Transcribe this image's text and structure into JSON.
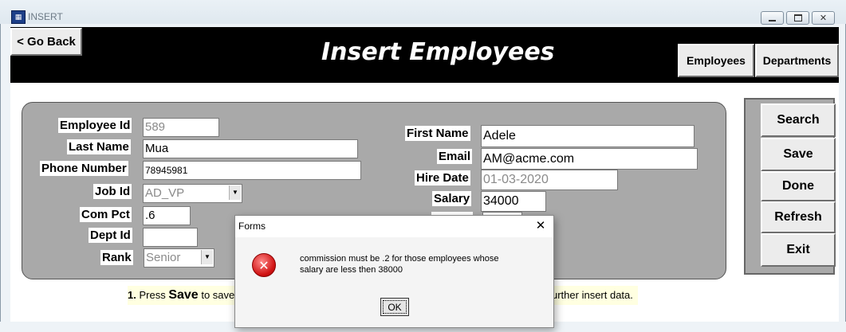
{
  "window": {
    "title": "INSERT",
    "icon": "app-icon",
    "controls": [
      "minimize-icon",
      "restore-icon",
      "close-icon"
    ]
  },
  "header": {
    "go_back": "< Go Back",
    "title": "Insert Employees",
    "nav": {
      "employees": "Employees",
      "departments": "Departments"
    }
  },
  "form": {
    "employee_id": {
      "label": "Employee Id",
      "value": "589"
    },
    "last_name": {
      "label": "Last Name",
      "value": "Mua"
    },
    "phone_number": {
      "label": "Phone Number",
      "value": "78945981"
    },
    "job_id": {
      "label": "Job Id",
      "value": "AD_VP"
    },
    "com_pct": {
      "label": "Com Pct",
      "value": ".6"
    },
    "dept_id": {
      "label": "Dept Id",
      "value": ""
    },
    "rank": {
      "label": "Rank",
      "value": "Senior"
    },
    "first_name": {
      "label": "First Name",
      "value": "Adele"
    },
    "email": {
      "label": "Email",
      "value": "AM@acme.com"
    },
    "hire_date": {
      "label": "Hire Date",
      "value": "01-03-2020"
    },
    "salary": {
      "label": "Salary",
      "value": "34000"
    }
  },
  "actions": {
    "search": "Search",
    "save": "Save",
    "done": "Done",
    "refresh": "Refresh",
    "exit": "Exit"
  },
  "instructions": {
    "num": "1.",
    "press": "Press",
    "save_word": "Save",
    "text": "to save",
    "tail": "urther insert data."
  },
  "dialog": {
    "title": "Forms",
    "close_glyph": "✕",
    "icon": "error-icon",
    "message_line1": "commission must be .2 for those employees whose",
    "message_line2": "salary are less then 38000",
    "ok": "OK"
  },
  "colors": {
    "header_bg": "#000000",
    "panel_bg": "#a9a9a9",
    "instruction_bg": "#ffffe1",
    "error_red": "#d11414"
  }
}
